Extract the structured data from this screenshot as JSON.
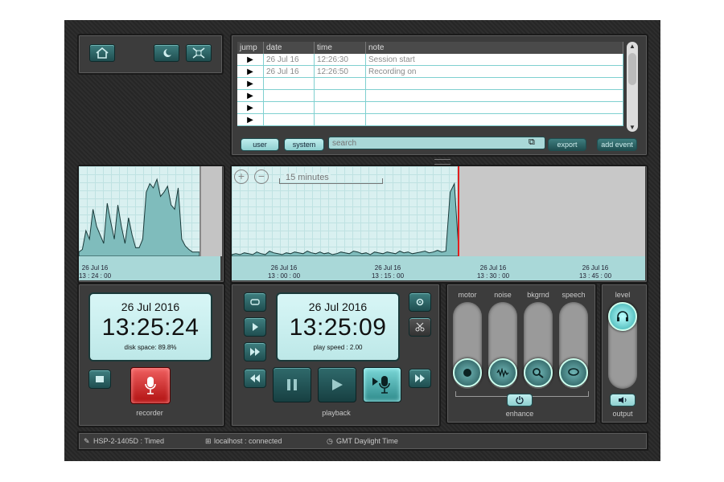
{
  "colors": {
    "accent": "#2f6a6b",
    "graph_bg": "#d9f0f0",
    "record_red": "#d82020",
    "playhead": "#e02020"
  },
  "toolbar": {
    "icons": [
      "home-icon",
      "night-mode-icon",
      "fit-icon"
    ]
  },
  "log": {
    "headers": [
      "jump",
      "date",
      "time",
      "note"
    ],
    "rows": [
      {
        "date": "26 Jul 16",
        "time": "12:26:30",
        "note": "Session start"
      },
      {
        "date": "26 Jul 16",
        "time": "12:26:50",
        "note": "Recording on"
      },
      {
        "date": "",
        "time": "",
        "note": ""
      },
      {
        "date": "",
        "time": "",
        "note": ""
      },
      {
        "date": "",
        "time": "",
        "note": ""
      },
      {
        "date": "",
        "time": "",
        "note": ""
      }
    ],
    "user_label": "user",
    "system_label": "system",
    "search_placeholder": "search",
    "export_label": "export",
    "add_event_label": "add event"
  },
  "overview": {
    "tick": {
      "date": "26 Jul 16",
      "time": "13 : 24 : 00"
    },
    "levels": [
      0.05,
      0.08,
      0.3,
      0.2,
      0.55,
      0.35,
      0.25,
      0.15,
      0.62,
      0.4,
      0.2,
      0.6,
      0.35,
      0.15,
      0.45,
      0.25,
      0.1,
      0.1,
      0.2,
      0.75,
      0.85,
      0.8,
      0.9,
      0.7,
      0.75,
      0.82,
      0.6,
      0.55,
      0.8,
      0.2,
      0.12,
      0.08,
      0.05,
      0.05,
      0.05
    ]
  },
  "timeline": {
    "scale_label": "15 minutes",
    "ticks": [
      {
        "date": "26 Jul 16",
        "time": "13 : 00 : 00"
      },
      {
        "date": "26 Jul 16",
        "time": "13 : 15 : 00"
      },
      {
        "date": "26 Jul 16",
        "time": "13 : 30 : 00"
      },
      {
        "date": "26 Jul 16",
        "time": "13 : 45 : 00"
      }
    ],
    "levels": [
      0.02,
      0.03,
      0.02,
      0.04,
      0.03,
      0.02,
      0.05,
      0.03,
      0.02,
      0.06,
      0.04,
      0.03,
      0.02,
      0.04,
      0.03,
      0.05,
      0.04,
      0.03,
      0.06,
      0.04,
      0.03,
      0.05,
      0.03,
      0.04,
      0.02,
      0.03,
      0.05,
      0.04,
      0.03,
      0.06,
      0.05,
      0.03,
      0.04,
      0.02,
      0.05,
      0.04,
      0.03,
      0.05,
      0.04,
      0.03,
      0.06,
      0.04,
      0.05,
      0.03,
      0.04,
      0.05,
      0.06,
      0.04,
      0.05,
      0.07,
      0.05,
      0.06,
      0.75,
      0.85,
      0.1
    ]
  },
  "recorder": {
    "date": "26 Jul 2016",
    "time": "13:25:24",
    "disk": "disk space: 89.8%",
    "label": "recorder"
  },
  "playback": {
    "date": "26 Jul 2016",
    "time": "13:25:09",
    "speed": "play speed : 2.00",
    "label": "playback"
  },
  "enhance": {
    "channels": [
      "motor",
      "noise",
      "bkgrnd",
      "speech"
    ],
    "label": "enhance"
  },
  "output": {
    "level_label": "level",
    "label": "output"
  },
  "status": {
    "device": "HSP-2-1405D : Timed",
    "server": "localhost : connected",
    "tz": "GMT Daylight Time"
  }
}
